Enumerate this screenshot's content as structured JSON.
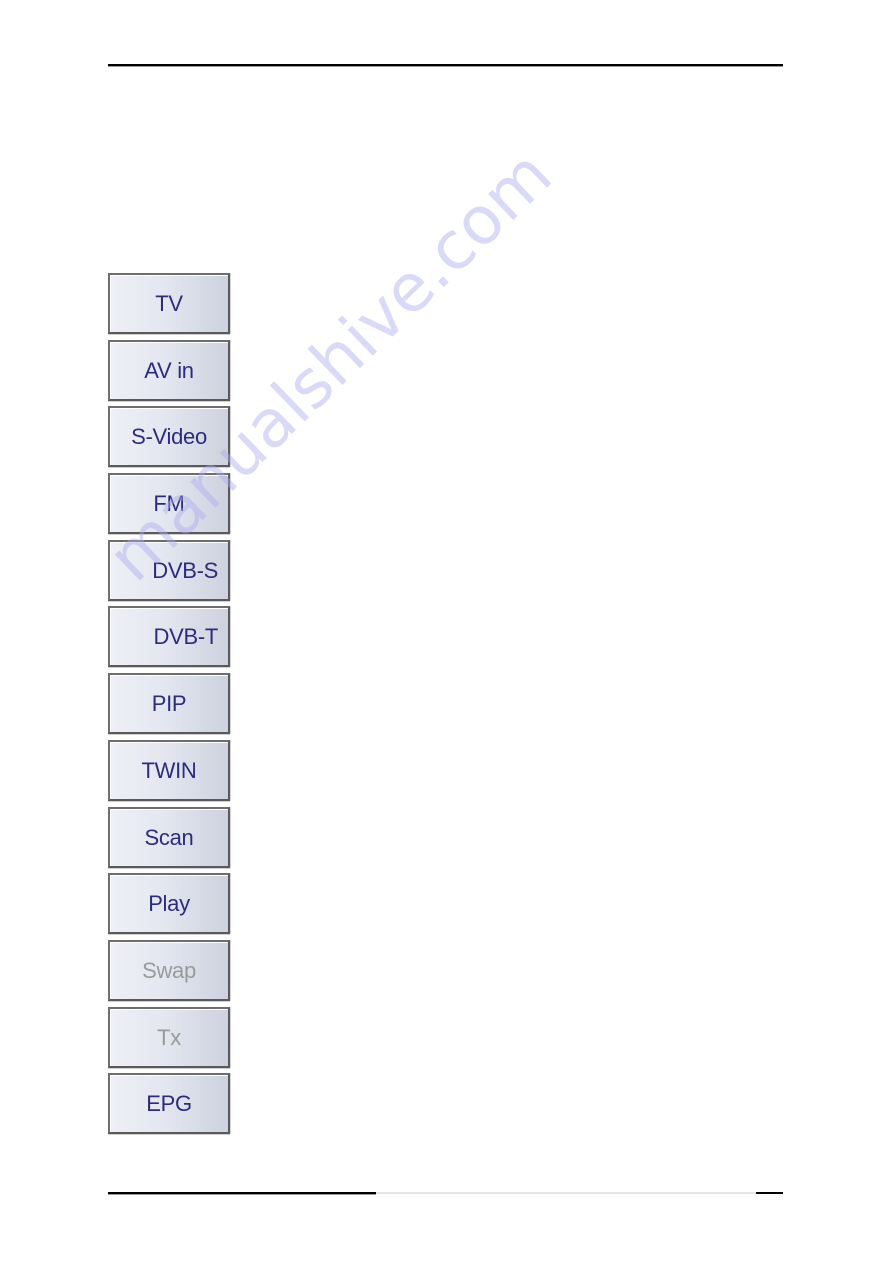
{
  "page": {
    "watermark": "manualshive.com"
  },
  "buttons": [
    {
      "label": "TV",
      "enabled": true
    },
    {
      "label": "AV in",
      "enabled": true
    },
    {
      "label": "S-Video",
      "enabled": true
    },
    {
      "label": "FM",
      "enabled": true
    },
    {
      "label": "DVB-S",
      "enabled": true
    },
    {
      "label": "DVB-T",
      "enabled": true
    },
    {
      "label": "PIP",
      "enabled": true
    },
    {
      "label": "TWIN",
      "enabled": true
    },
    {
      "label": "Scan",
      "enabled": true
    },
    {
      "label": "Play",
      "enabled": true
    },
    {
      "label": "Swap",
      "enabled": false
    },
    {
      "label": "Tx",
      "enabled": false
    },
    {
      "label": "EPG",
      "enabled": true
    }
  ],
  "colors": {
    "label_enabled": "#2b2d7c",
    "label_disabled": "#9a9a9a"
  }
}
